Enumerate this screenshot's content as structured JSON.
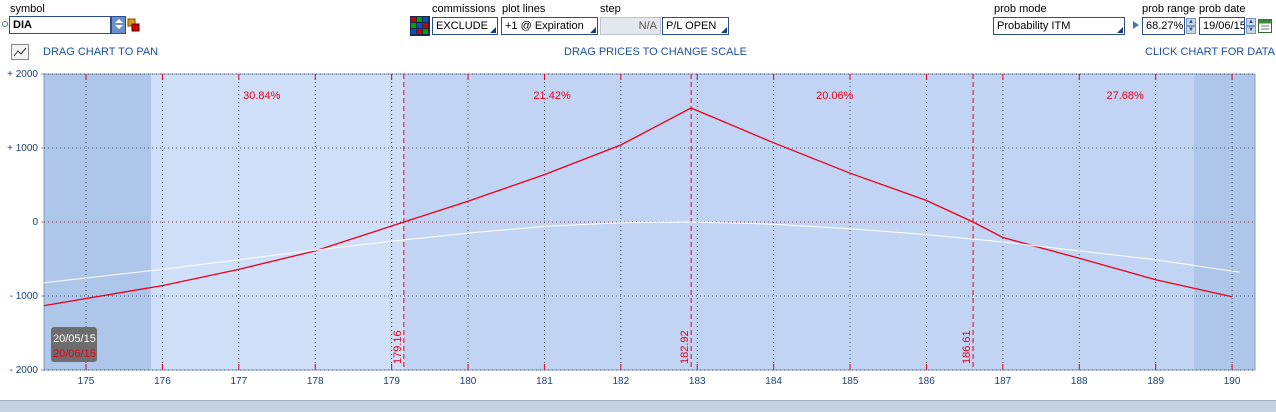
{
  "toolbar": {
    "symbol_label": "symbol",
    "symbol_value": "DIA",
    "commissions_label": "commissions",
    "commissions_value": "EXCLUDE",
    "plot_lines_label": "plot lines",
    "plot_lines_value": "+1 @ Expiration",
    "step_label": "step",
    "step_value": "N/A",
    "pl_value": "P/L OPEN",
    "prob_mode_label": "prob mode",
    "prob_mode_value": "Probability ITM",
    "prob_range_label": "prob range",
    "prob_range_value": "68.27%",
    "prob_date_label": "prob date",
    "prob_date_value": "19/06/15"
  },
  "hints": {
    "pan": "DRAG CHART TO PAN",
    "scale": "DRAG PRICES TO CHANGE SCALE",
    "data": "CLICK CHART FOR DATA"
  },
  "chart_data": {
    "type": "line",
    "xlim": [
      174.45,
      190.3
    ],
    "ylim": [
      -2000,
      2000
    ],
    "x_ticks": [
      175,
      176,
      177,
      178,
      179,
      180,
      181,
      182,
      183,
      184,
      185,
      186,
      187,
      188,
      189,
      190
    ],
    "y_ticks": [
      {
        "value": 2000,
        "label": "+ 2000"
      },
      {
        "value": 1000,
        "label": "+ 1000"
      },
      {
        "value": 0,
        "label": "0"
      },
      {
        "value": -1000,
        "label": "- 1000"
      },
      {
        "value": -2000,
        "label": "- 2000"
      }
    ],
    "prob_band": [
      175.85,
      189.5
    ],
    "breakevens": [
      {
        "x": 179.16,
        "label": "179.16"
      },
      {
        "x": 182.92,
        "label": "182.92"
      },
      {
        "x": 186.61,
        "label": "186.61"
      }
    ],
    "zone_probabilities": [
      {
        "x": 177.3,
        "label": "30.84%"
      },
      {
        "x": 181.1,
        "label": "21.42%"
      },
      {
        "x": 184.8,
        "label": "20.06%"
      },
      {
        "x": 188.6,
        "label": "27.68%"
      }
    ],
    "grid": true,
    "series": [
      {
        "color": "#e8001c",
        "x": [
          174.45,
          176,
          177,
          178,
          179.16,
          180,
          181,
          182,
          182.92,
          184,
          185,
          186,
          186.61,
          187,
          188,
          189,
          190
        ],
        "y": [
          -1130,
          -860,
          -640,
          -390,
          0,
          280,
          640,
          1040,
          1540,
          1070,
          660,
          290,
          0,
          -210,
          -490,
          -780,
          -1010
        ]
      },
      {
        "color": "#ffffff",
        "x": [
          174.45,
          176,
          177,
          178,
          179,
          180,
          181,
          182,
          182.92,
          184,
          185,
          186,
          187,
          188,
          189,
          190.1
        ],
        "y": [
          -820,
          -640,
          -510,
          -380,
          -260,
          -150,
          -60,
          -10,
          0,
          -30,
          -90,
          -170,
          -270,
          -390,
          -510,
          -680
        ]
      }
    ],
    "date_labels": [
      {
        "label": "20/05/15",
        "color": "#ffffff"
      },
      {
        "label": "20/06/15",
        "color": "#e8001c"
      }
    ]
  },
  "colors": {
    "plot_bg": "#c1d4f3",
    "band_bg": "#cfdff8",
    "edge_bg": "#adc6ea",
    "profit_line": "#e8001c",
    "theo_line": "#ffffff",
    "axis_text": "#1b3f78",
    "hint_text": "#1b4f9c"
  }
}
